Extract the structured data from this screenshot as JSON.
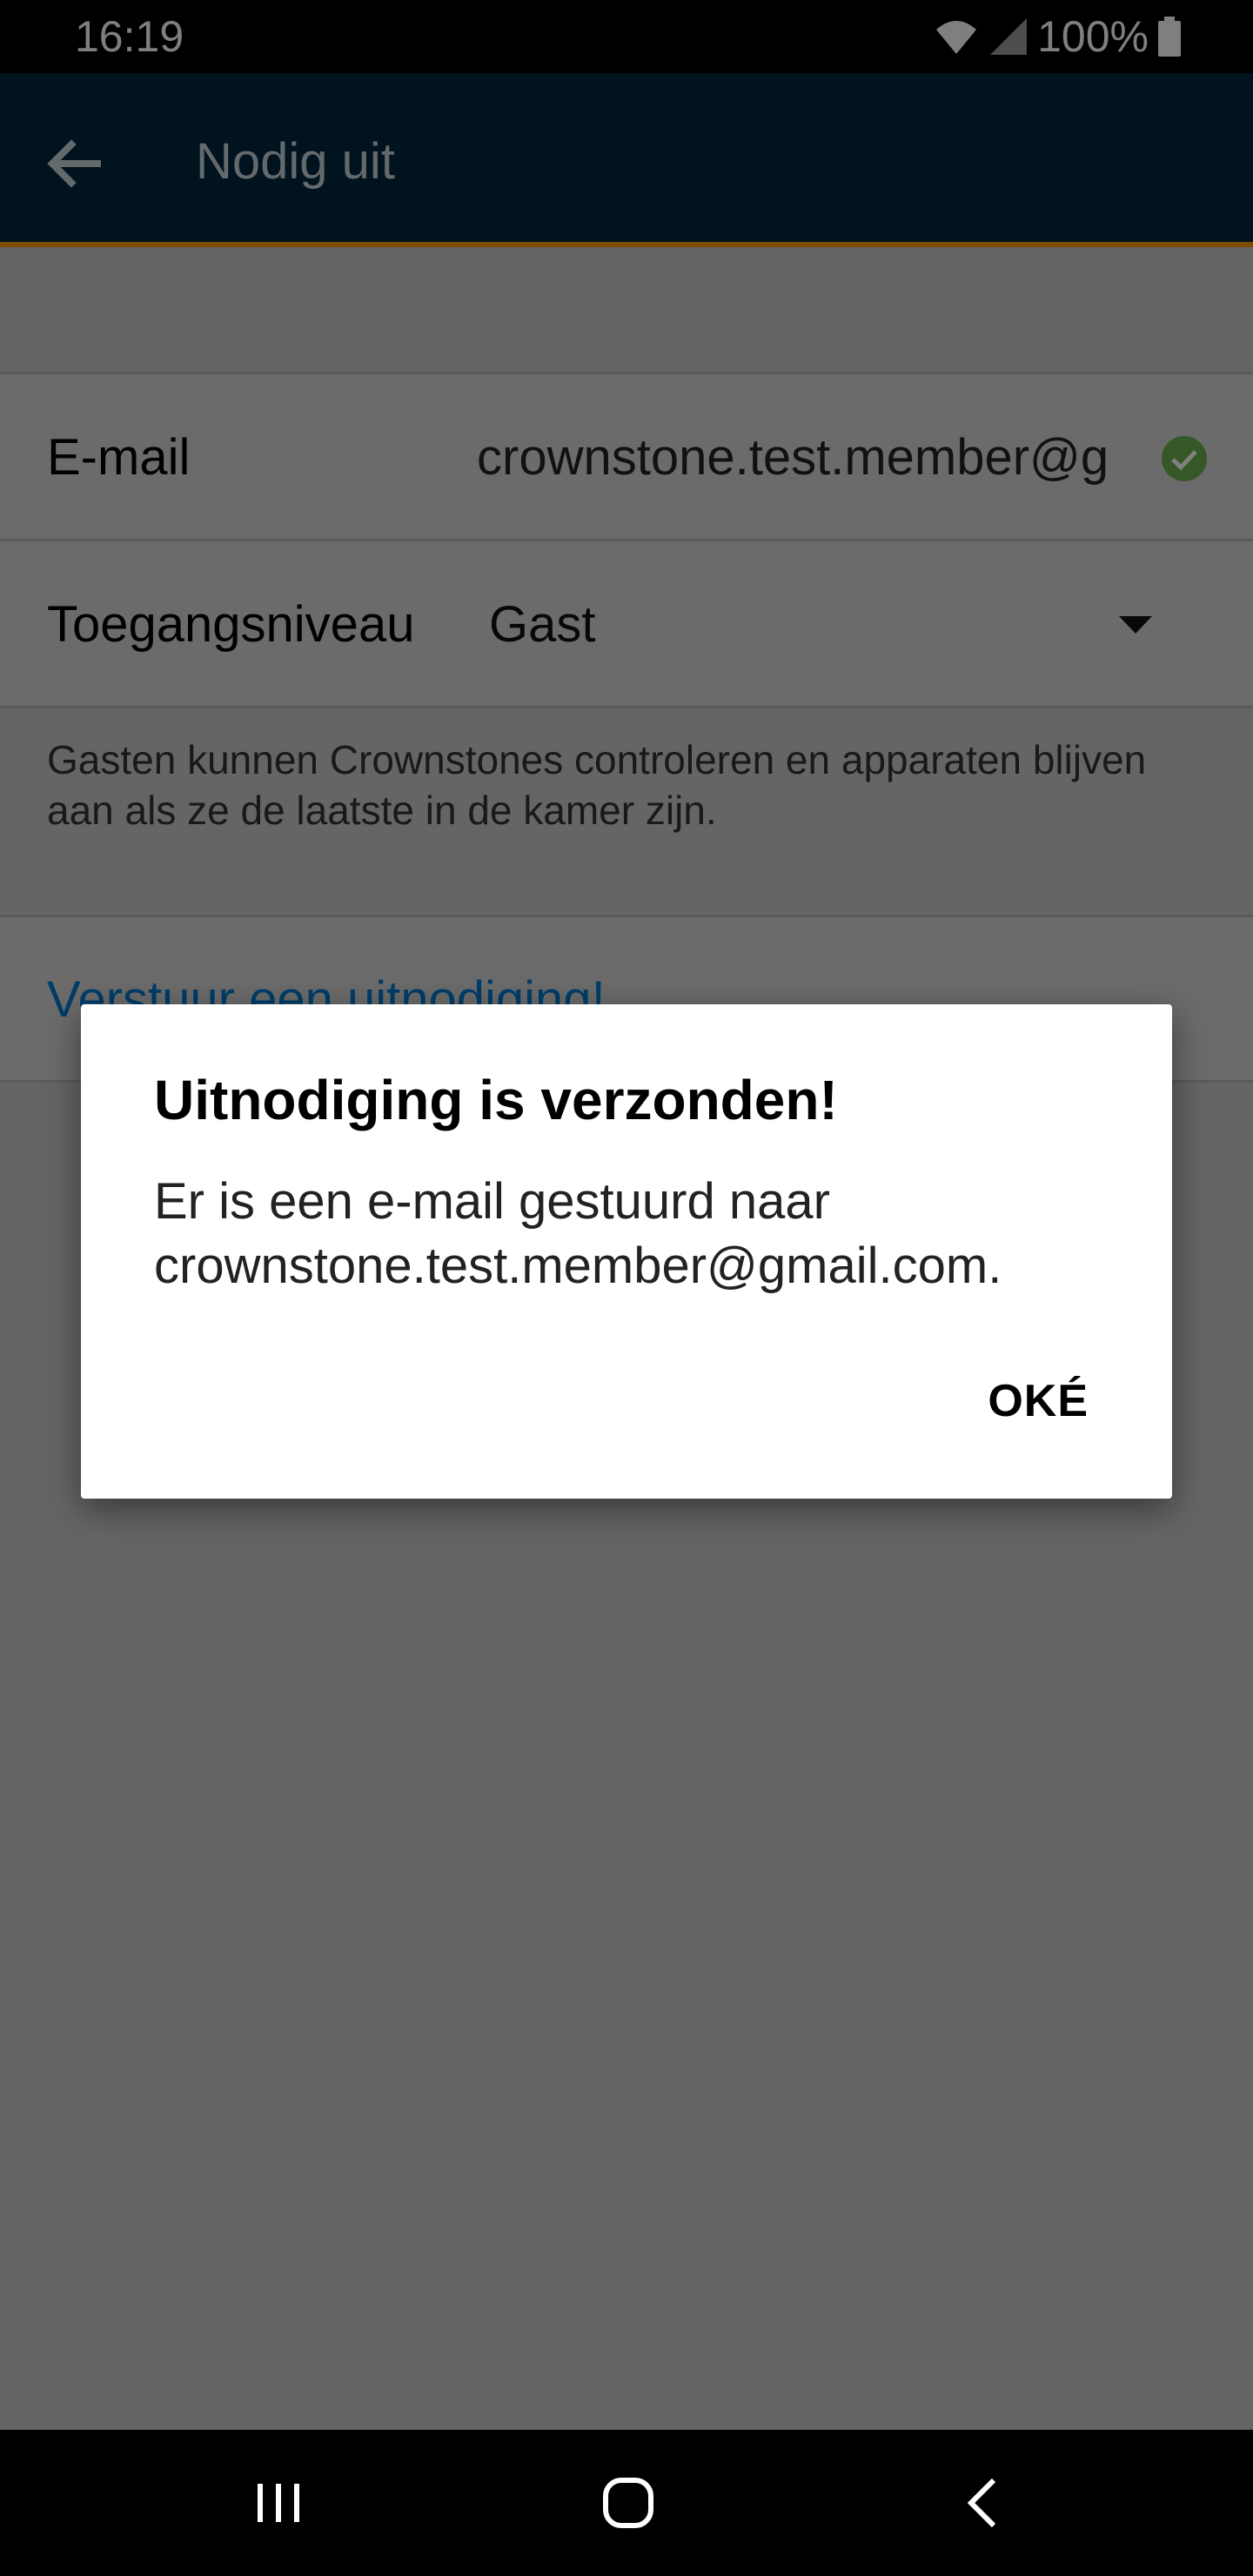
{
  "status_bar": {
    "time": "16:19",
    "battery": "100%",
    "icons": [
      "wifi-icon",
      "cell-signal-icon",
      "battery-icon"
    ]
  },
  "header": {
    "title": "Nodig uit",
    "back_icon": "arrow-left-icon",
    "background_color": "#00263e",
    "accent_color": "#ff9800"
  },
  "form": {
    "email": {
      "label": "E-mail",
      "value": "crownstone.test.member@g",
      "status_icon": "check-circle-icon",
      "status_color": "#6ab04c"
    },
    "access_level": {
      "label": "Toegangsniveau",
      "value": "Gast",
      "dropdown_icon": "caret-down-icon"
    },
    "description": "Gasten kunnen Crownstones controleren en apparaten blijven aan als ze de laatste in de kamer zijn.",
    "send_button": "Verstuur een uitnodiging!",
    "link_color": "#007ad1"
  },
  "dialog": {
    "title": "Uitnodiging is verzonden!",
    "message": "Er is een e-mail gestuurd naar crownstone.test.member@gmail.com.",
    "ok_button": "OKÉ"
  },
  "nav_bar": {
    "icons": [
      "recent-apps-icon",
      "home-icon",
      "back-icon"
    ]
  }
}
